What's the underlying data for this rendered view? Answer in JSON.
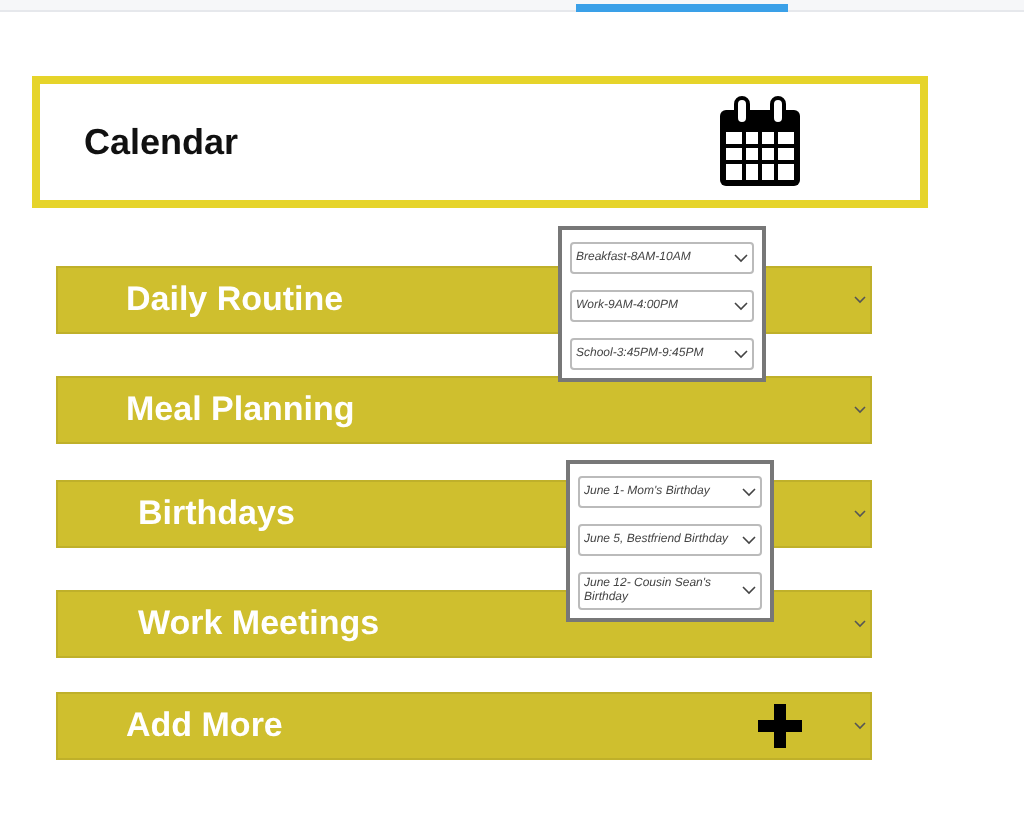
{
  "header": {
    "title": "Calendar"
  },
  "sections": [
    {
      "kind": "section",
      "label": "Daily Routine",
      "options": [
        "Breakfast-8AM-10AM",
        "Work-9AM-4:00PM",
        "School-3:45PM-9:45PM"
      ]
    },
    {
      "kind": "section",
      "label": "Meal Planning"
    },
    {
      "kind": "section",
      "label": "Birthdays",
      "options": [
        "June 1- Mom's  Birthday",
        "June 5, Bestfriend Birthday",
        "June  12- Cousin Sean's Birthday"
      ]
    },
    {
      "kind": "section",
      "label": "Work Meetings"
    },
    {
      "kind": "add",
      "label": "Add More"
    }
  ]
}
